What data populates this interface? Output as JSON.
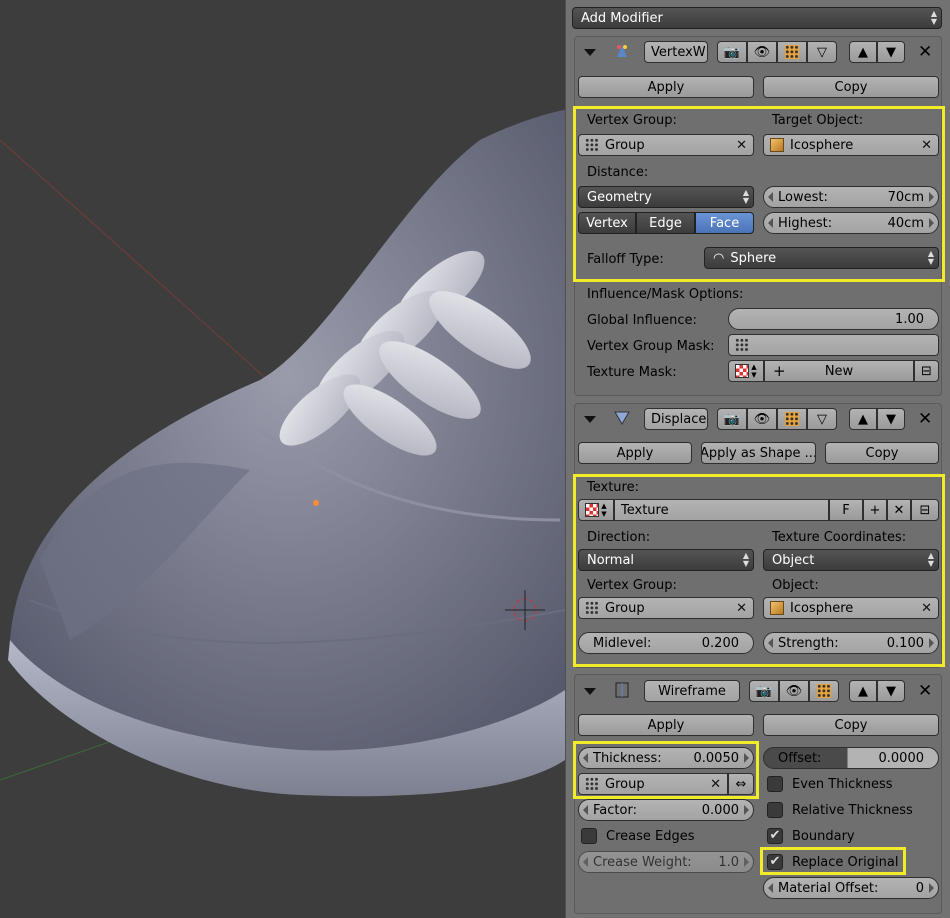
{
  "add_modifier": {
    "label": "Add Modifier"
  },
  "vertexweight": {
    "name": "VertexW",
    "apply": "Apply",
    "copy": "Copy",
    "vertex_group_label": "Vertex Group:",
    "vertex_group_value": "Group",
    "target_object_label": "Target Object:",
    "target_object_value": "Icosphere",
    "distance_label": "Distance:",
    "distance_value": "Geometry",
    "lowest_label": "Lowest:",
    "lowest_value": "70cm",
    "highest_label": "Highest:",
    "highest_value": "40cm",
    "mode_vertex": "Vertex",
    "mode_edge": "Edge",
    "mode_face": "Face",
    "falloff_label": "Falloff Type:",
    "falloff_value": "Sphere",
    "influence_label": "Influence/Mask Options:",
    "global_influence_label": "Global Influence:",
    "global_influence_value": "1.00",
    "vgroup_mask_label": "Vertex Group Mask:",
    "texture_mask_label": "Texture Mask:",
    "new_label": "New"
  },
  "displace": {
    "name": "Displace",
    "apply": "Apply",
    "apply_shape": "Apply as Shape ...",
    "copy": "Copy",
    "texture_label": "Texture:",
    "texture_value": "Texture",
    "f_label": "F",
    "direction_label": "Direction:",
    "direction_value": "Normal",
    "texcoords_label": "Texture Coordinates:",
    "texcoords_value": "Object",
    "vertex_group_label": "Vertex Group:",
    "vertex_group_value": "Group",
    "object_label": "Object:",
    "object_value": "Icosphere",
    "midlevel_label": "Midlevel:",
    "midlevel_value": "0.200",
    "strength_label": "Strength:",
    "strength_value": "0.100"
  },
  "wireframe": {
    "name": "Wireframe",
    "apply": "Apply",
    "copy": "Copy",
    "thickness_label": "Thickness:",
    "thickness_value": "0.0050",
    "offset_label": "Offset:",
    "offset_value": "0.0000",
    "group_value": "Group",
    "even_thickness": "Even Thickness",
    "relative_thickness": "Relative Thickness",
    "factor_label": "Factor:",
    "factor_value": "0.000",
    "crease_edges": "Crease Edges",
    "boundary": "Boundary",
    "crease_weight_label": "Crease Weight:",
    "crease_weight_value": "1.0",
    "replace_original": "Replace Original",
    "material_offset_label": "Material Offset:",
    "material_offset_value": "0",
    "boundary_checked": true,
    "replace_original_checked": true
  },
  "colors": {
    "highlight": "#f0ec2a",
    "active_blue": "#5680c2",
    "panel_bg": "#727272",
    "viewport_bg": "#3d3d3d"
  },
  "icons": [
    "vertexweight-modifier-icon",
    "displace-modifier-icon",
    "wireframe-modifier-icon",
    "camera-icon",
    "eye-icon",
    "editmode-icon",
    "cage-icon",
    "move-up-icon",
    "move-down-icon",
    "close-icon",
    "group-dots-icon",
    "cube-object-icon",
    "sphere-falloff-icon",
    "checker-texture-icon",
    "plus-icon",
    "swap-icon"
  ]
}
